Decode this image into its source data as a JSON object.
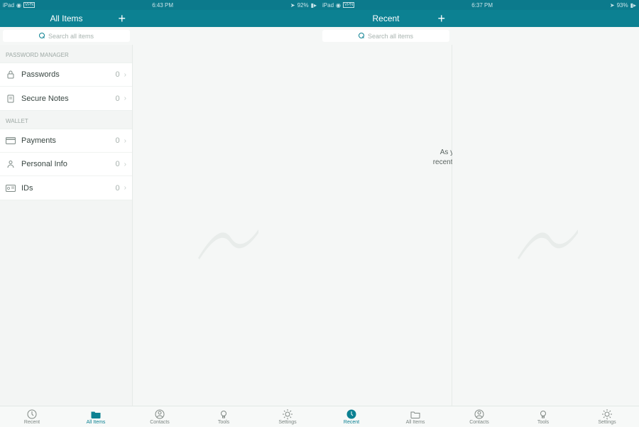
{
  "device1": {
    "status": {
      "left": "iPad",
      "vpn": "VPN",
      "time": "6:43 PM",
      "battery": "92%"
    },
    "sidebar_header": {
      "title": "All Items"
    },
    "main_header": {
      "title": ""
    },
    "search": {
      "placeholder": "Search all items"
    },
    "sections": [
      {
        "title": "PASSWORD MANAGER",
        "items": [
          {
            "icon": "lock-icon",
            "label": "Passwords",
            "count": "0"
          },
          {
            "icon": "note-icon",
            "label": "Secure Notes",
            "count": "0"
          }
        ]
      },
      {
        "title": "WALLET",
        "items": [
          {
            "icon": "card-icon",
            "label": "Payments",
            "count": "0"
          },
          {
            "icon": "person-icon",
            "label": "Personal Info",
            "count": "0"
          },
          {
            "icon": "id-icon",
            "label": "IDs",
            "count": "0"
          }
        ]
      }
    ],
    "tabs": [
      {
        "id": "recent",
        "label": "Recent",
        "active": false
      },
      {
        "id": "allitems",
        "label": "All Items",
        "active": true
      },
      {
        "id": "contacts",
        "label": "Contacts",
        "active": false
      },
      {
        "id": "tools",
        "label": "Tools",
        "active": false
      },
      {
        "id": "settings",
        "label": "Settings",
        "active": false
      }
    ]
  },
  "device2": {
    "status": {
      "left": "iPad",
      "vpn": "VPN",
      "time": "6:37 PM",
      "battery": "93%"
    },
    "sidebar_header": {
      "title": "Recent"
    },
    "search": {
      "placeholder": "Search all items"
    },
    "empty_line1": "As you use the app, your",
    "empty_line2": "recent items will appear here.",
    "tabs": [
      {
        "id": "recent",
        "label": "Recent",
        "active": true
      },
      {
        "id": "allitems",
        "label": "All Items",
        "active": false
      },
      {
        "id": "contacts",
        "label": "Contacts",
        "active": false
      },
      {
        "id": "tools",
        "label": "Tools",
        "active": false
      },
      {
        "id": "settings",
        "label": "Settings",
        "active": false
      }
    ]
  }
}
